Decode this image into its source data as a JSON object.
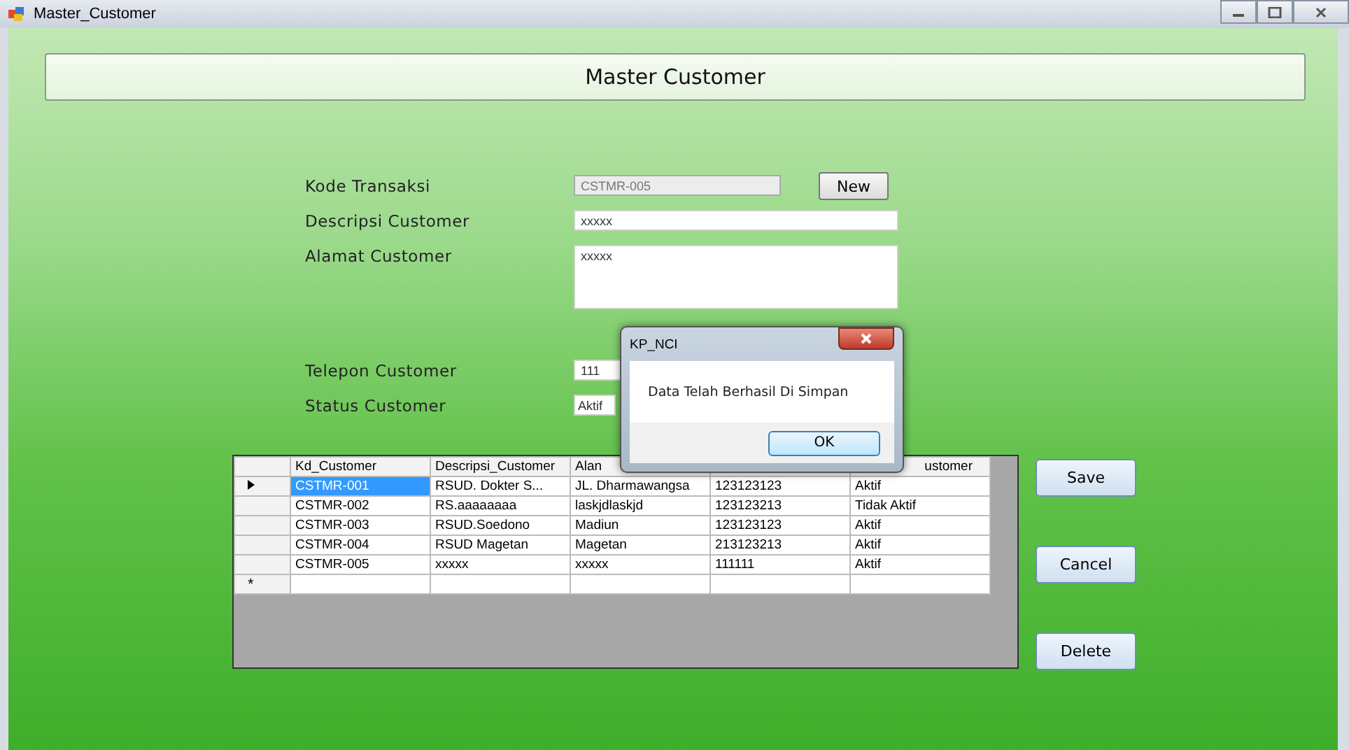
{
  "window": {
    "title": "Master_Customer"
  },
  "header": {
    "title": "Master Customer"
  },
  "form": {
    "fields": [
      {
        "label": "Kode Transaksi",
        "kind": "readonly",
        "value": "CSTMR-005"
      },
      {
        "label": "Descripsi Customer",
        "kind": "text",
        "value": "xxxxx"
      },
      {
        "label": "Alamat Customer",
        "kind": "multiline",
        "value": "xxxxx"
      },
      {
        "label": "Telepon Customer",
        "kind": "text",
        "value": "111"
      },
      {
        "label": "Status Customer",
        "kind": "short",
        "value": "Aktif"
      }
    ],
    "new_button": "New"
  },
  "grid": {
    "columns": [
      "Kd_Customer",
      "Descripsi_Customer",
      "Alan",
      "",
      "ustomer"
    ],
    "rows": [
      {
        "selected": true,
        "cells": [
          "CSTMR-001",
          "RSUD. Dokter S...",
          "JL. Dharmawangsa",
          "123123123",
          "Aktif"
        ]
      },
      {
        "selected": false,
        "cells": [
          "CSTMR-002",
          "RS.aaaaaaaa",
          "laskjdlaskjd",
          "123123213",
          "Tidak Aktif"
        ]
      },
      {
        "selected": false,
        "cells": [
          "CSTMR-003",
          "RSUD.Soedono",
          "Madiun",
          "123123123",
          "Aktif"
        ]
      },
      {
        "selected": false,
        "cells": [
          "CSTMR-004",
          "RSUD Magetan",
          "Magetan",
          "213123213",
          "Aktif"
        ]
      },
      {
        "selected": false,
        "cells": [
          "CSTMR-005",
          "xxxxx",
          "xxxxx",
          "111111",
          "Aktif"
        ]
      }
    ],
    "new_row_marker": "*"
  },
  "buttons": [
    "Save",
    "Cancel",
    "Delete"
  ],
  "dialog": {
    "title": "KP_NCI",
    "message": "Data Telah Berhasil Di Simpan",
    "button": "OK"
  }
}
